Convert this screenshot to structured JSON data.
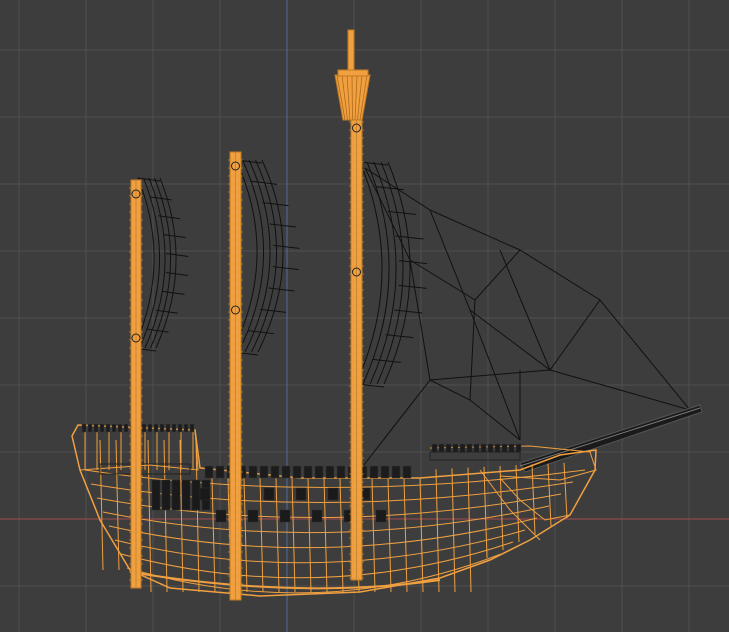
{
  "viewport": {
    "mode": "wireframe-3d-viewport",
    "background_color": "#3d3d3d",
    "grid_color": "#505050",
    "x_axis_color": "#a34a4a",
    "z_axis_color": "#4f6a9e",
    "selection_color": "#f0a040",
    "unselected_wire_color": "#111111"
  },
  "objects": [
    {
      "name": "ship-hull",
      "selected": true
    },
    {
      "name": "mizzen-mast",
      "selected": true
    },
    {
      "name": "main-mast",
      "selected": true
    },
    {
      "name": "fore-mast",
      "selected": true
    },
    {
      "name": "mizzen-sail",
      "selected": false
    },
    {
      "name": "main-sail",
      "selected": false
    },
    {
      "name": "fore-sail",
      "selected": false
    },
    {
      "name": "jib-sail-rigging",
      "selected": false
    },
    {
      "name": "bowsprit",
      "selected": false
    },
    {
      "name": "deck-railing",
      "selected": false
    }
  ]
}
